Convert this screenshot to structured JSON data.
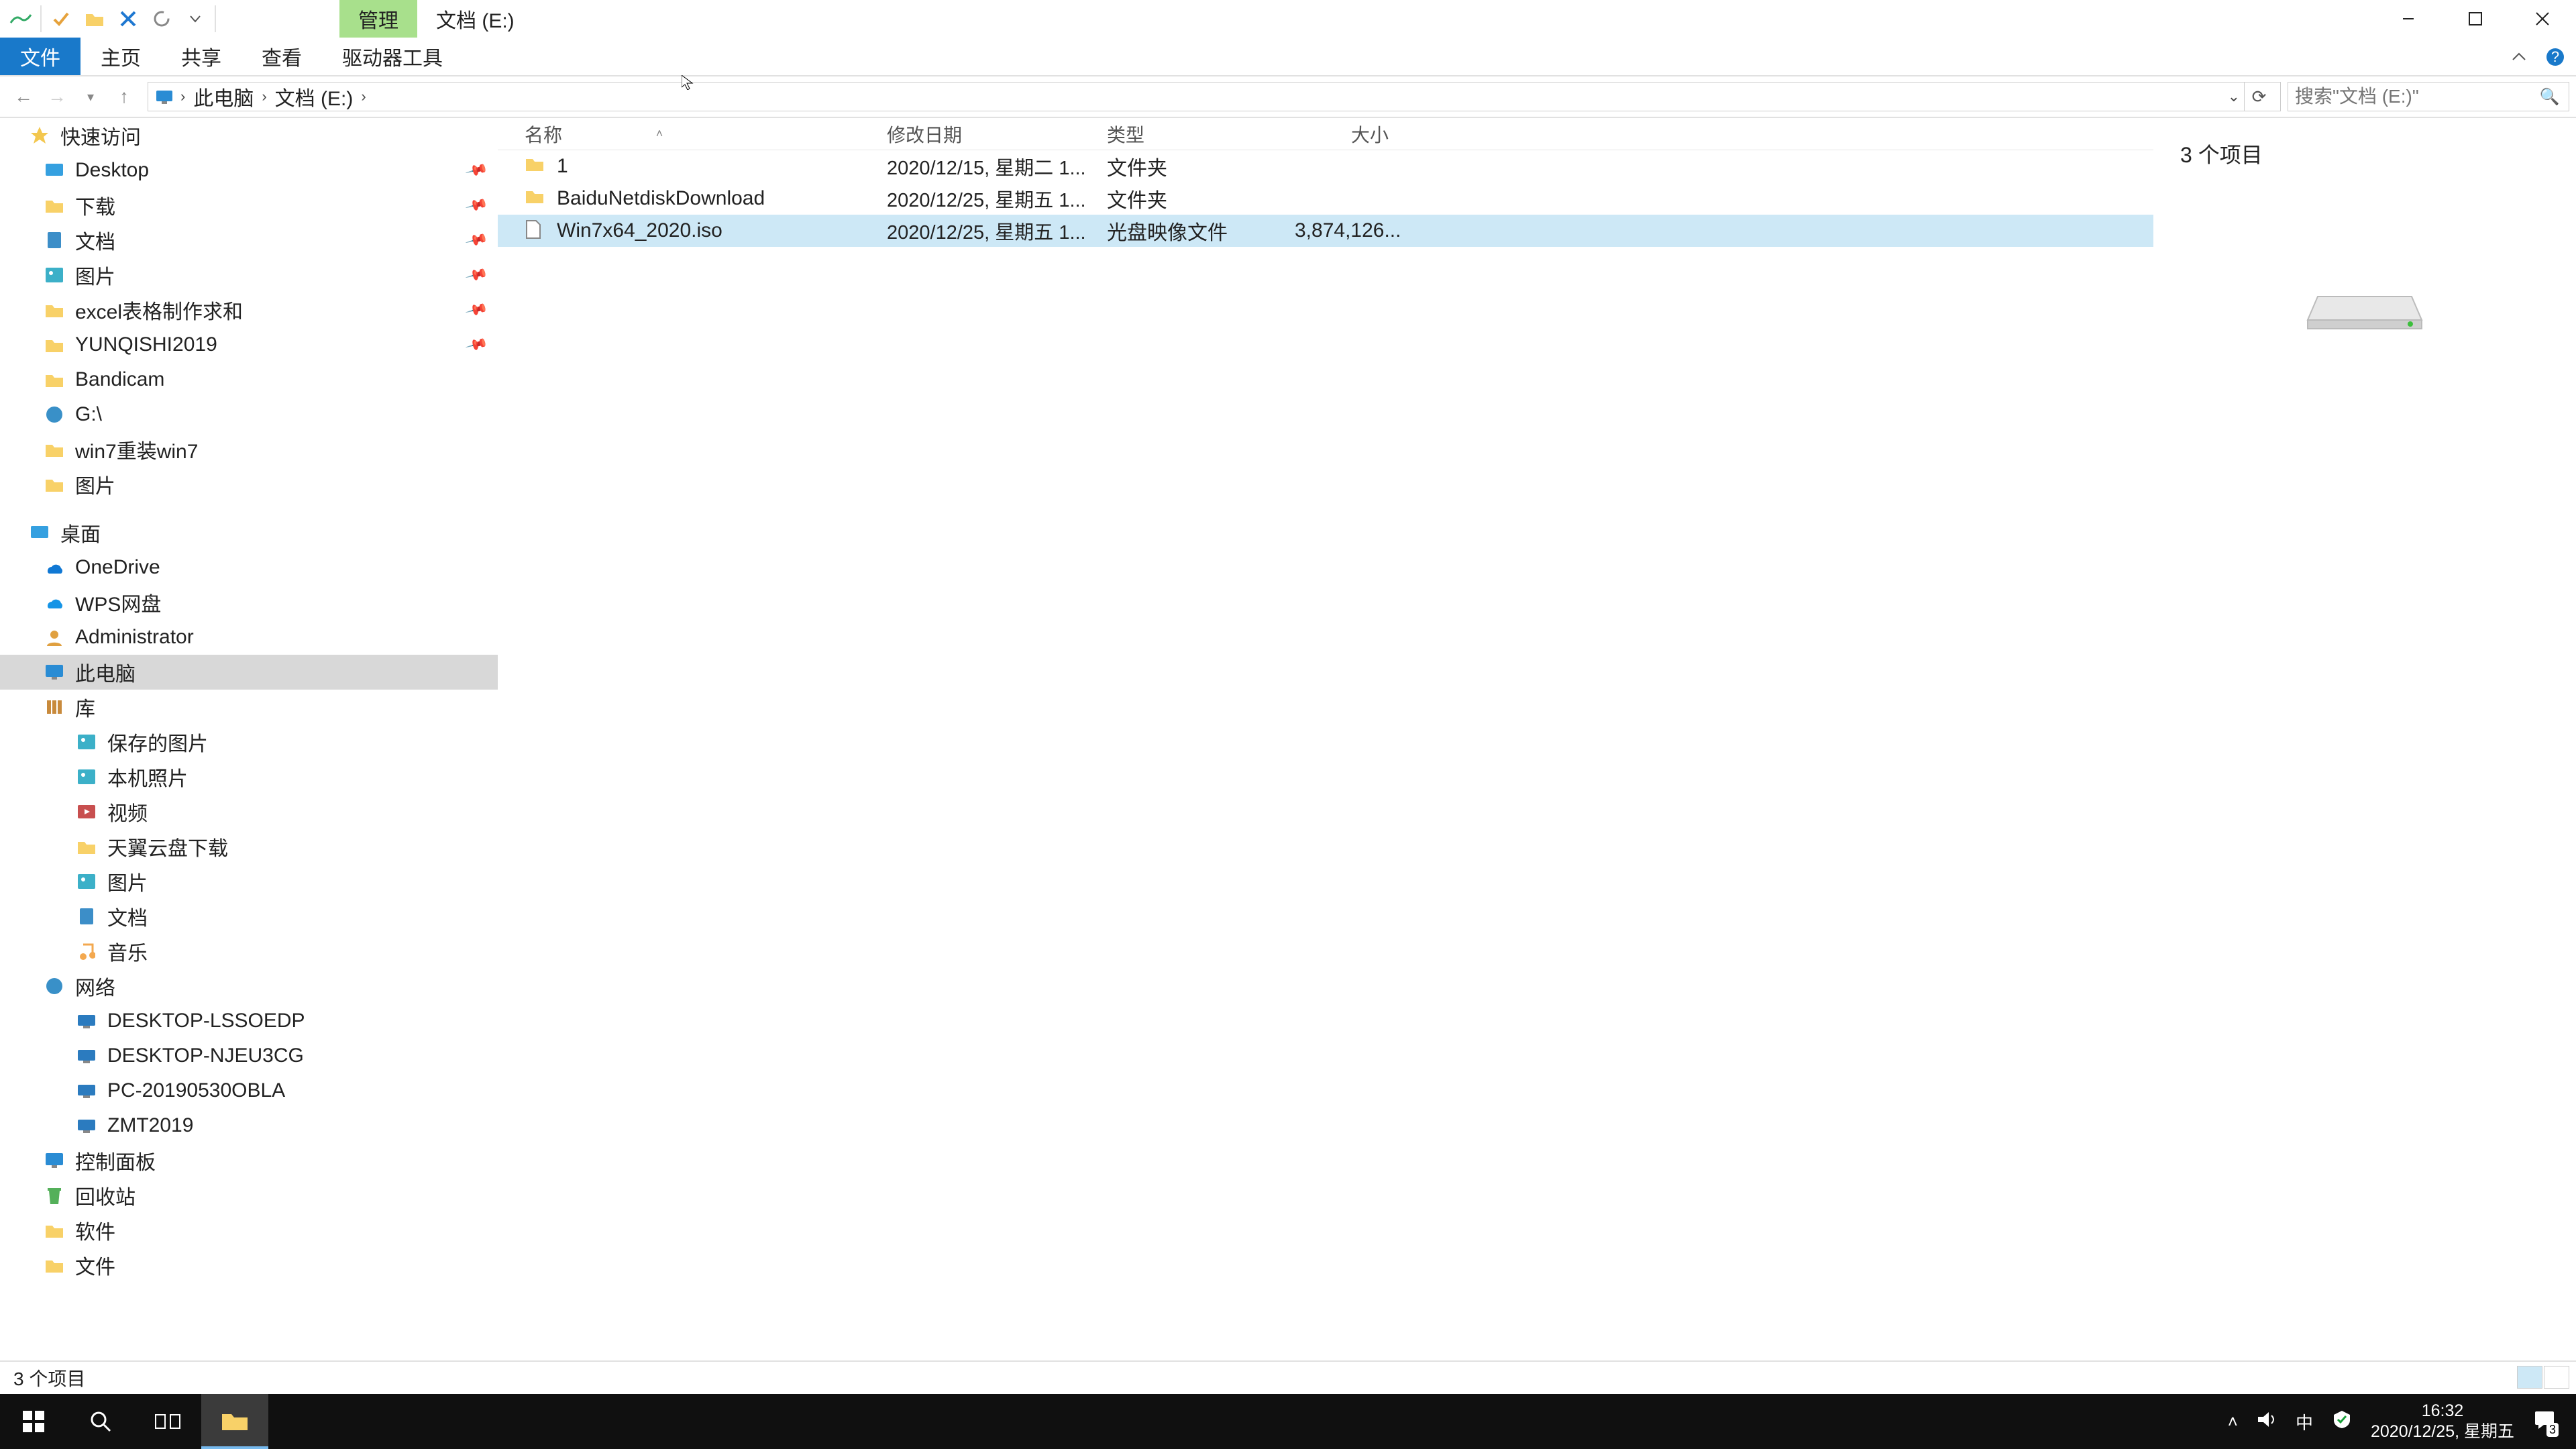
{
  "title": {
    "context_tab": "管理",
    "window_title": "文档 (E:)"
  },
  "ribbon": {
    "tabs": {
      "file": "文件",
      "home": "主页",
      "share": "共享",
      "view": "查看",
      "drive_tools": "驱动器工具"
    }
  },
  "breadcrumb": {
    "root_icon": "pc",
    "crumbs": [
      "此电脑",
      "文档 (E:)"
    ]
  },
  "search": {
    "placeholder": "搜索\"文档 (E:)\""
  },
  "nav": {
    "quick_access": "快速访问",
    "qa_items": [
      {
        "label": "Desktop",
        "icon": "desk",
        "pinned": true
      },
      {
        "label": "下载",
        "icon": "folder",
        "pinned": true
      },
      {
        "label": "文档",
        "icon": "doc",
        "pinned": true
      },
      {
        "label": "图片",
        "icon": "pic",
        "pinned": true
      },
      {
        "label": "excel表格制作求和",
        "icon": "folder",
        "pinned": true
      },
      {
        "label": "YUNQISHI2019",
        "icon": "folder",
        "pinned": true
      },
      {
        "label": "Bandicam",
        "icon": "folder",
        "pinned": false
      },
      {
        "label": "G:\\",
        "icon": "net",
        "pinned": false
      },
      {
        "label": "win7重装win7",
        "icon": "folder",
        "pinned": false
      },
      {
        "label": "图片",
        "icon": "folder",
        "pinned": false
      }
    ],
    "desktop": "桌面",
    "desktop_items": [
      {
        "label": "OneDrive",
        "icon": "od"
      },
      {
        "label": "WPS网盘",
        "icon": "wps"
      },
      {
        "label": "Administrator",
        "icon": "usr"
      },
      {
        "label": "此电脑",
        "icon": "mon",
        "selected": true
      },
      {
        "label": "库",
        "icon": "lib"
      }
    ],
    "library_items": [
      {
        "label": "保存的图片",
        "icon": "pic"
      },
      {
        "label": "本机照片",
        "icon": "pic"
      },
      {
        "label": "视频",
        "icon": "vid"
      },
      {
        "label": "天翼云盘下载",
        "icon": "folder"
      },
      {
        "label": "图片",
        "icon": "pic"
      },
      {
        "label": "文档",
        "icon": "doc"
      },
      {
        "label": "音乐",
        "icon": "mus"
      }
    ],
    "network": "网络",
    "network_items": [
      {
        "label": "DESKTOP-LSSOEDP",
        "icon": "pc"
      },
      {
        "label": "DESKTOP-NJEU3CG",
        "icon": "pc"
      },
      {
        "label": "PC-20190530OBLA",
        "icon": "pc"
      },
      {
        "label": "ZMT2019",
        "icon": "pc"
      }
    ],
    "other": [
      {
        "label": "控制面板",
        "icon": "mon"
      },
      {
        "label": "回收站",
        "icon": "rcy"
      },
      {
        "label": "软件",
        "icon": "folder"
      },
      {
        "label": "文件",
        "icon": "folder"
      }
    ]
  },
  "columns": {
    "name": "名称",
    "date": "修改日期",
    "type": "类型",
    "size": "大小"
  },
  "files": [
    {
      "name": "1",
      "date": "2020/12/15, 星期二 1...",
      "type": "文件夹",
      "size": "",
      "icon": "folder",
      "selected": false
    },
    {
      "name": "BaiduNetdiskDownload",
      "date": "2020/12/25, 星期五 1...",
      "type": "文件夹",
      "size": "",
      "icon": "folder",
      "selected": false
    },
    {
      "name": "Win7x64_2020.iso",
      "date": "2020/12/25, 星期五 1...",
      "type": "光盘映像文件",
      "size": "3,874,126...",
      "icon": "file",
      "selected": true
    }
  ],
  "preview": {
    "title": "3 个项目"
  },
  "status": {
    "text": "3 个项目"
  },
  "tray": {
    "ime": "中",
    "time": "16:32",
    "date": "2020/12/25, 星期五",
    "badge": "3"
  }
}
